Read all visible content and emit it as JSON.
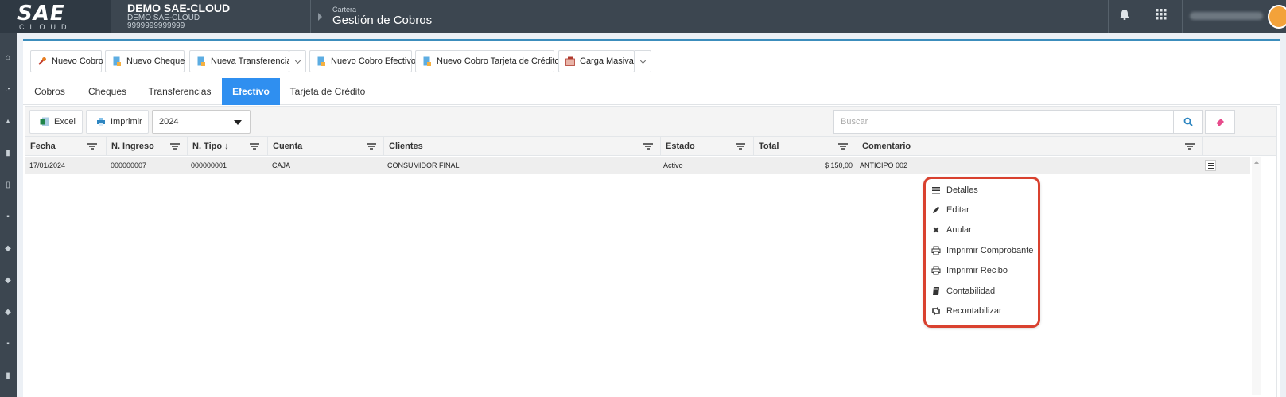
{
  "header": {
    "logo_text": "SAE",
    "logo_sub": "CLOUD",
    "company_name": "DEMO SAE-CLOUD",
    "company_sub": "DEMO SAE-CLOUD",
    "company_id": "9999999999999",
    "breadcrumb_parent": "Cartera",
    "breadcrumb_title": "Gestión de Cobros"
  },
  "toolbar": {
    "nuevo_cobro": "Nuevo Cobro",
    "nuevo_cheque": "Nuevo Cheque",
    "nueva_transferencia": "Nueva Transferencia",
    "nuevo_cobro_efectivo": "Nuevo Cobro Efectivo",
    "nuevo_cobro_tarjeta": "Nuevo Cobro Tarjeta de Crédito",
    "carga_masiva": "Carga Masiva"
  },
  "tabs": [
    "Cobros",
    "Cheques",
    "Transferencias",
    "Efectivo",
    "Tarjeta de Crédito"
  ],
  "active_tab": "Efectivo",
  "grid_toolbar": {
    "excel": "Excel",
    "imprimir": "Imprimir",
    "year": "2024",
    "search_placeholder": "Buscar"
  },
  "columns": [
    "Fecha",
    "N. Ingreso",
    "N. Tipo ↓",
    "Cuenta",
    "Clientes",
    "Estado",
    "Total",
    "Comentario"
  ],
  "rows": [
    {
      "fecha": "17/01/2024",
      "ingreso": "000000007",
      "tipo": "000000001",
      "cuenta": "CAJA",
      "cliente": "CONSUMIDOR FINAL",
      "estado": "Activo",
      "total": "$ 150,00",
      "comentario": "ANTICIPO 002"
    }
  ],
  "context_menu": [
    "Detalles",
    "Editar",
    "Anular",
    "Imprimir Comprobante",
    "Imprimir Recibo",
    "Contabilidad",
    "Recontabilizar"
  ],
  "colors": {
    "accent": "#2f8ff0",
    "topbar": "#3c4650",
    "highlight": "#d9412f"
  }
}
